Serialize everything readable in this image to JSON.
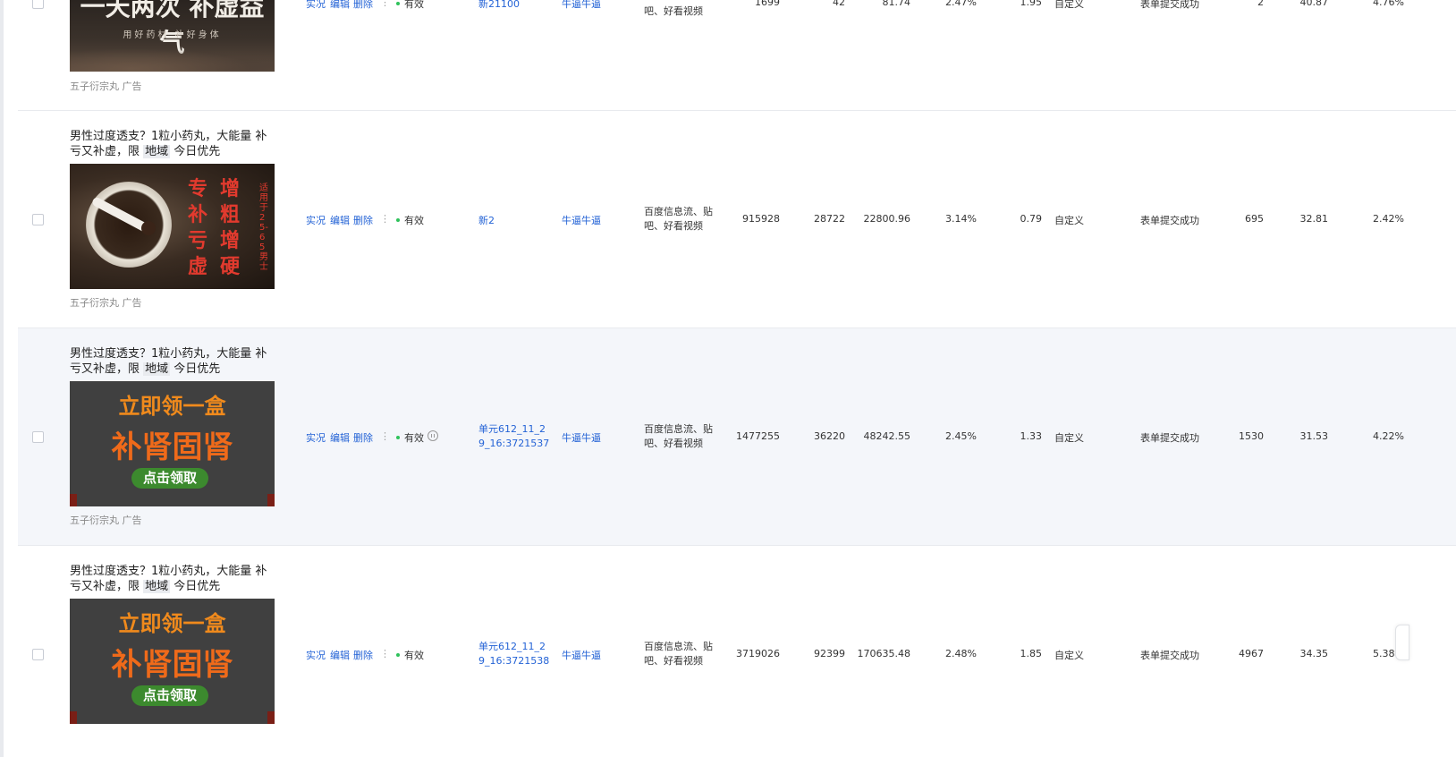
{
  "rows": [
    {
      "title_a": "",
      "title_tag": "",
      "title_b": "",
      "image": {
        "line1": "一天两次 补虚益气",
        "line2": "用好药材 补好身体"
      },
      "source": "五子衍宗丸 广告",
      "actions": {
        "live": "实况",
        "edit": "编辑",
        "delete": "删除",
        "more": "⋮"
      },
      "status": "有效",
      "unit": "新21100",
      "plan": "牛逼牛逼",
      "placement": "吧、好看视频",
      "impressions": "1699",
      "clicks": "42",
      "cost": "81.74",
      "ctr": "2.47%",
      "cpc": "1.95",
      "bid_type": "自定义",
      "conversion": "表单提交成功",
      "conv_count": "2",
      "conv_cost": "40.87",
      "conv_rate": "4.76%"
    },
    {
      "title_a": "男性过度透支？1粒小药丸，大能量 补亏又补虚，限 ",
      "title_tag": "地域",
      "title_b": " 今日优先",
      "image": {
        "col1": "专补亏虚",
        "col2": "增粗增硬",
        "side": "适用于25-65男士"
      },
      "source": "五子衍宗丸 广告",
      "actions": {
        "live": "实况",
        "edit": "编辑",
        "delete": "删除",
        "more": "⋮"
      },
      "status": "有效",
      "unit": "新2",
      "plan": "牛逼牛逼",
      "placement": "百度信息流、贴吧、好看视频",
      "impressions": "915928",
      "clicks": "28722",
      "cost": "22800.96",
      "ctr": "3.14%",
      "cpc": "0.79",
      "bid_type": "自定义",
      "conversion": "表单提交成功",
      "conv_count": "695",
      "conv_cost": "32.81",
      "conv_rate": "2.42%"
    },
    {
      "title_a": "男性过度透支？1粒小药丸，大能量 补亏又补虚，限 ",
      "title_tag": "地域",
      "title_b": " 今日优先",
      "image": {
        "line1": "立即领一盒",
        "line2": "补肾固肾",
        "button": "点击领取"
      },
      "source": "五子衍宗丸 广告",
      "actions": {
        "live": "实况",
        "edit": "编辑",
        "delete": "删除",
        "more": "⋮"
      },
      "status": "有效",
      "unit": "单元612_11_29_16:3721537",
      "plan": "牛逼牛逼",
      "placement": "百度信息流、贴吧、好看视频",
      "impressions": "1477255",
      "clicks": "36220",
      "cost": "48242.55",
      "ctr": "2.45%",
      "cpc": "1.33",
      "bid_type": "自定义",
      "conversion": "表单提交成功",
      "conv_count": "1530",
      "conv_cost": "31.53",
      "conv_rate": "4.22%"
    },
    {
      "title_a": "男性过度透支？1粒小药丸，大能量 补亏又补虚，限 ",
      "title_tag": "地域",
      "title_b": " 今日优先",
      "image": {
        "line1": "立即领一盒",
        "line2": "补肾固肾",
        "button": "点击领取"
      },
      "source": "",
      "actions": {
        "live": "实况",
        "edit": "编辑",
        "delete": "删除",
        "more": "⋮"
      },
      "status": "有效",
      "unit": "单元612_11_29_16:3721538",
      "plan": "牛逼牛逼",
      "placement": "百度信息流、贴吧、好看视频",
      "impressions": "3719026",
      "clicks": "92399",
      "cost": "170635.48",
      "ctr": "2.48%",
      "cpc": "1.85",
      "bid_type": "自定义",
      "conversion": "表单提交成功",
      "conv_count": "4967",
      "conv_cost": "34.35",
      "conv_rate": "5.38%"
    }
  ],
  "colors": {
    "link": "#2463d6",
    "status_dot": "#2fc25b",
    "highlight_row": "#f4f6fa"
  }
}
